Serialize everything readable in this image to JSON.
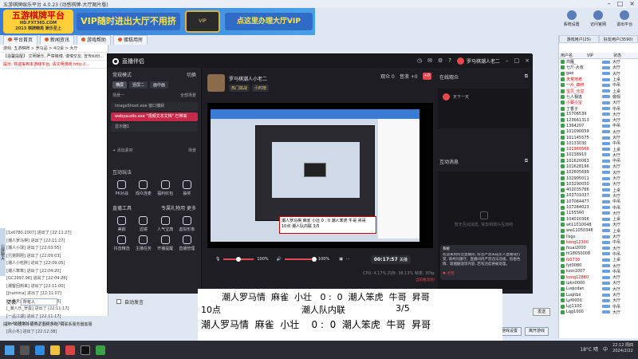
{
  "host": {
    "title": "五游棋牌娱乐平台 4.0.23 (动感棋牌-大厅图片版)",
    "logo_main": "五游棋牌平台",
    "logo_sub": "HD.FXT365.COM",
    "logo_tagline": "2013 棋牌精英 娱乐至上",
    "banner_left": "VIP随时进出大厅不用挤",
    "banner_crest": "VIP",
    "banner_right": "点这里办理大厅VIP",
    "tools": [
      {
        "label": "系统设置"
      },
      {
        "label": "访问官网"
      },
      {
        "label": "退出平台"
      }
    ],
    "nav_tabs": [
      "平台首页",
      "新闻资讯",
      "游戏帮助",
      "蛋糕用房"
    ],
    "left_info": [
      {
        "text": "游戏: 五游棋牌 > 罗马品 > 4/2桌 > 大厅",
        "red": false
      },
      {
        "text": "【温馨提醒】 文明娱乐, 严禁赌博, 谨慎交友, 宣传纠纷...",
        "red": false
      },
      {
        "text": "提示: 欢迎来到本游戏平台, 请文明游戏 http://...",
        "red": true
      }
    ],
    "side_tab": "公屏聊天",
    "history": [
      "[1x6780.2007] 进出了 [22:11:27]",
      "[潮人罗马棋] 进出了 [22:11:27]",
      "[潮人小球] 进出了 [22:03:55]",
      "[兄弟刚刚] 进出了 [22:09:03]",
      "[潮人小吃胖] 进出了 [22:09:05]",
      "[潮人笨笨] 进出了 [22:04:20]",
      "[GC2997.96] 进出了 [22:04:26]",
      "[潮客回到来] 进出了 [22:11:00]",
      "[Jhamma] 进出了 [22:11:07]",
      "[大美天涯] 进出了 [22:11:13]",
      "[_潮人乐_罗曼] 进出了 [22:11:17]",
      "[一品江湖] 进出了 [22:11:17]",
      "[fn420690] 进出了 [22:12:00]",
      "[风小冬] 进出了 [22:12:38]"
    ],
    "chat_label": "交谈:",
    "chat_target": "所有人",
    "chk_label": "自动发言",
    "send_label": "发送",
    "tip": "提示: 如遇意外请务必重启游戏, 请联系服务器客服",
    "actions": [
      "游戏设置",
      "离开游戏"
    ]
  },
  "users": {
    "tabs": [
      "游戏用户(25)",
      "好友用户(3590)"
    ],
    "headers": [
      "用户名",
      "VIP",
      "状态"
    ],
    "rows": [
      {
        "name": "鸿雁_",
        "loc": "大厅",
        "red": false
      },
      {
        "name": "七斤-大叔",
        "loc": "大厅",
        "red": false
      },
      {
        "name": "gao",
        "loc": "大厅",
        "red": false
      },
      {
        "name": "天荒地老",
        "loc": "上桌",
        "red": true
      },
      {
        "name": "一片_森林",
        "loc": "中吊",
        "red": true
      },
      {
        "name": "宝贝_元宝",
        "loc": "上桌",
        "red": true
      },
      {
        "name": "七人相逢",
        "loc": "旁观",
        "red": false
      },
      {
        "name": "小蔡小宝",
        "loc": "大厅",
        "red": true
      },
      {
        "name": "丁香子",
        "loc": "中吊",
        "red": false
      },
      {
        "name": "15706539",
        "loc": "大厅",
        "red": false
      },
      {
        "name": "123661313",
        "loc": "大厅",
        "red": false
      },
      {
        "name": "1364207",
        "loc": "中吊",
        "red": false
      },
      {
        "name": "101090059",
        "loc": "大厅",
        "red": false
      },
      {
        "name": "101145575",
        "loc": "大厅",
        "red": false
      },
      {
        "name": "10133030",
        "loc": "中吊",
        "red": false
      },
      {
        "name": "101960566",
        "loc": "上桌",
        "red": true
      },
      {
        "name": "10238910",
        "loc": "大厅",
        "red": false
      },
      {
        "name": "101620063",
        "loc": "中吊",
        "red": false
      },
      {
        "name": "101628196",
        "loc": "大厅",
        "red": false
      },
      {
        "name": "102605699",
        "loc": "大厅",
        "red": false
      },
      {
        "name": "102905011",
        "loc": "大厅",
        "red": false
      },
      {
        "name": "103290050",
        "loc": "大厅",
        "red": false
      },
      {
        "name": "402035766",
        "loc": "上桌",
        "red": false
      },
      {
        "name": "103701037",
        "loc": "大厅",
        "red": false
      },
      {
        "name": "107064477",
        "loc": "中吊",
        "red": false
      },
      {
        "name": "107264023",
        "loc": "中吊",
        "red": false
      },
      {
        "name": "1155560",
        "loc": "大厅",
        "red": false
      },
      {
        "name": "104010306",
        "loc": "上桌",
        "red": false
      },
      {
        "name": "wt11010048",
        "loc": "大厅",
        "red": false
      },
      {
        "name": "ww11050346",
        "loc": "上桌",
        "red": false
      },
      {
        "name": "llsgx",
        "loc": "大厅",
        "red": false
      },
      {
        "name": "kong12300",
        "loc": "中吊",
        "red": true
      },
      {
        "name": "fsuai2000",
        "loc": "大厅",
        "red": false
      },
      {
        "name": "hl18050008",
        "loc": "中吊",
        "red": false
      },
      {
        "name": "fz0730",
        "loc": "上桌",
        "red": true
      },
      {
        "name": "fyt0080",
        "loc": "大厅",
        "red": false
      },
      {
        "name": "kzss1007",
        "loc": "中吊",
        "red": false
      },
      {
        "name": "kong12880",
        "loc": "大厅",
        "red": true
      },
      {
        "name": "ipkn0000",
        "loc": "大厅",
        "red": false
      },
      {
        "name": "Luqicdan",
        "loc": "大厅",
        "red": false
      },
      {
        "name": "Luqitbii",
        "loc": "大厅",
        "red": false
      },
      {
        "name": "Lyf0000",
        "loc": "大厅",
        "red": false
      },
      {
        "name": "Lyj1100",
        "loc": "中吊",
        "red": false
      },
      {
        "name": "Lqg1000",
        "loc": "大厅",
        "red": false
      }
    ]
  },
  "stream": {
    "app_title": "直播伴侣",
    "title_icons": [
      "开播设置",
      "消息",
      "设置",
      "帮助"
    ],
    "user_name": "罗马棋潮人老二",
    "section_mode": "常规模式",
    "section_mode_right": "切换",
    "modes": [
      "横屏",
      "竖屏二",
      "画中画"
    ],
    "scene_label": "场景一",
    "scene_right": "全部场景",
    "sources": [
      {
        "label": "ImageShoot.exe 窗口捕获",
        "active": false
      },
      {
        "label": "webpaudio.exe \"视频文本文档\" 已带来",
        "active": true
      },
      {
        "label": "显示器1",
        "active": false
      }
    ],
    "add_source": "+ 添加素材",
    "add_source_right": "场景",
    "section_interact": "互动玩法",
    "interact_grid": [
      "PK对战",
      "观众连麦",
      "福利红包",
      "抽奖"
    ],
    "section_tools": "直播工具",
    "tools_right": "专属礼物用 更多",
    "tools_grid": [
      "美颜",
      "滤镜",
      "人气宝典",
      "虚拟形象",
      "抖音精选",
      "主播任务",
      "开播提醒",
      "直播管理"
    ],
    "anchor_name": "罗马棋潮人小老二",
    "anchor_tags": [
      "热门挑战",
      "小时榜"
    ],
    "anchor_stats": [
      "观众 0",
      "音浪 +0"
    ],
    "hot_badge": "+0",
    "overlay_lines": [
      "潮人罗马棋 麻雀 小壮 0 : 0 潮人笨虎 牛哥 昇哥",
      "10点 潮人队内联 3/5"
    ],
    "mic_pct": "100%",
    "speaker_pct": "100%",
    "timer": "00:17:57",
    "timer_label": "关播",
    "status": "CPU: 4.17%   内存: 38.13%   帧率: 30fps   码率: 1913kbps",
    "status2": "当前推流地址: 2000000",
    "online_title": "在线观众",
    "viewer_name": "天下一天",
    "interact_title": "互动消息",
    "interact_empty": "暂无互动消息, 快去和观众互动吧",
    "msg_from": "系统",
    "msg_body": "欢迎来到抖音直播间, 抖音严禁未成年人直播或打赏, 请共同遵守。直播间内严禁违法违规、低俗色情、吸烟酗酒等内容, 若有违反将被处理。",
    "msg_like": "♥ 点赞"
  },
  "scoreboard": {
    "line1": "潮人罗马情  麻雀  小壮   0 :  0  潮人笨虎  牛哥  昇哥",
    "line2a": "10点",
    "line2b": "潮人队内联",
    "line2c": "3/5",
    "line3": "潮人罗马情  麻雀  小壮    0 :  0  潮人笨虎  牛哥  昇哥"
  },
  "taskbar": {
    "weather": "18°C 晴",
    "lang": "中",
    "time": "22:12 周四",
    "date": "2024/2/22"
  },
  "colors": {
    "accent_red": "#c7294a",
    "host_blue": "#3a7bd5",
    "vip_yellow": "#ffe44d"
  }
}
